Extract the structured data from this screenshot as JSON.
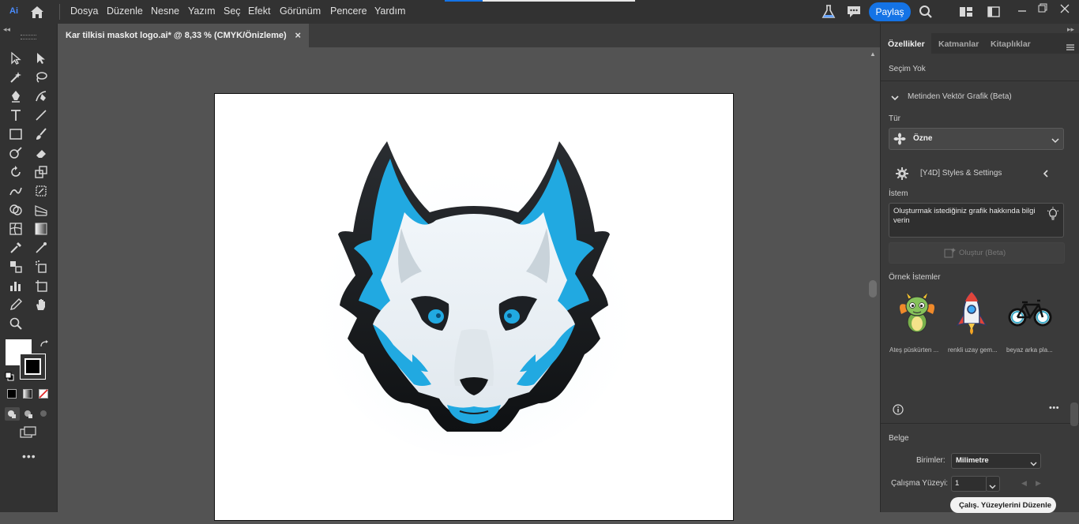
{
  "app": {
    "logo": "Ai"
  },
  "menu": [
    "Dosya",
    "Düzenle",
    "Nesne",
    "Yazım",
    "Seç",
    "Efekt",
    "Görünüm",
    "Pencere",
    "Yardım"
  ],
  "header": {
    "share_label": "Paylaş",
    "accent": "#1473e6"
  },
  "document": {
    "tab_title": "Kar tilkisi maskot logo.ai* @ 8,33 % (CMYK/Önizleme)",
    "close_glyph": "×"
  },
  "panel": {
    "tabs": [
      "Özellikler",
      "Katmanlar",
      "Kitaplıklar"
    ],
    "selection": "Seçim Yok",
    "section_title": "Metinden Vektör Grafik (Beta)",
    "type_label": "Tür",
    "type_value": "Özne",
    "styles_label": "[Y4D] Styles & Settings",
    "prompt_label": "İstem",
    "prompt_placeholder": "Oluşturmak istediğiniz grafik hakkında bilgi verin",
    "generate_label": "Oluştur (Beta)",
    "samples_label": "Örnek İstemler",
    "samples": [
      "Ateş püskürten ...",
      "renkli uzay gem...",
      "beyaz arka pla..."
    ],
    "document_section": "Belge",
    "units_label": "Birimler:",
    "units_value": "Milimetre",
    "artboard_label": "Çalışma Yüzeyi:",
    "artboard_value": "1",
    "edit_artboards_label": "Çalış. Yüzeylerini Düzenle"
  }
}
